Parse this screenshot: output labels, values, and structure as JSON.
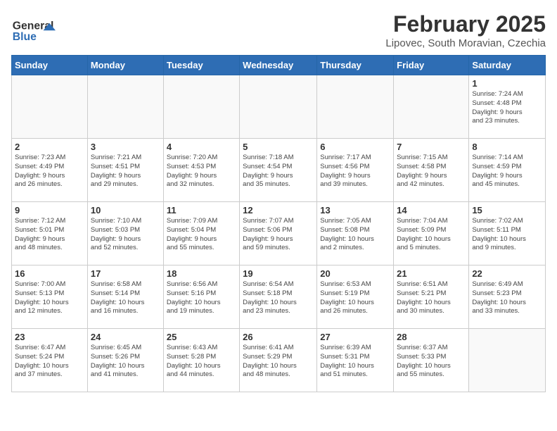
{
  "header": {
    "logo_line1": "General",
    "logo_line2": "Blue",
    "title": "February 2025",
    "subtitle": "Lipovec, South Moravian, Czechia"
  },
  "weekdays": [
    "Sunday",
    "Monday",
    "Tuesday",
    "Wednesday",
    "Thursday",
    "Friday",
    "Saturday"
  ],
  "weeks": [
    [
      {
        "day": "",
        "info": ""
      },
      {
        "day": "",
        "info": ""
      },
      {
        "day": "",
        "info": ""
      },
      {
        "day": "",
        "info": ""
      },
      {
        "day": "",
        "info": ""
      },
      {
        "day": "",
        "info": ""
      },
      {
        "day": "1",
        "info": "Sunrise: 7:24 AM\nSunset: 4:48 PM\nDaylight: 9 hours\nand 23 minutes."
      }
    ],
    [
      {
        "day": "2",
        "info": "Sunrise: 7:23 AM\nSunset: 4:49 PM\nDaylight: 9 hours\nand 26 minutes."
      },
      {
        "day": "3",
        "info": "Sunrise: 7:21 AM\nSunset: 4:51 PM\nDaylight: 9 hours\nand 29 minutes."
      },
      {
        "day": "4",
        "info": "Sunrise: 7:20 AM\nSunset: 4:53 PM\nDaylight: 9 hours\nand 32 minutes."
      },
      {
        "day": "5",
        "info": "Sunrise: 7:18 AM\nSunset: 4:54 PM\nDaylight: 9 hours\nand 35 minutes."
      },
      {
        "day": "6",
        "info": "Sunrise: 7:17 AM\nSunset: 4:56 PM\nDaylight: 9 hours\nand 39 minutes."
      },
      {
        "day": "7",
        "info": "Sunrise: 7:15 AM\nSunset: 4:58 PM\nDaylight: 9 hours\nand 42 minutes."
      },
      {
        "day": "8",
        "info": "Sunrise: 7:14 AM\nSunset: 4:59 PM\nDaylight: 9 hours\nand 45 minutes."
      }
    ],
    [
      {
        "day": "9",
        "info": "Sunrise: 7:12 AM\nSunset: 5:01 PM\nDaylight: 9 hours\nand 48 minutes."
      },
      {
        "day": "10",
        "info": "Sunrise: 7:10 AM\nSunset: 5:03 PM\nDaylight: 9 hours\nand 52 minutes."
      },
      {
        "day": "11",
        "info": "Sunrise: 7:09 AM\nSunset: 5:04 PM\nDaylight: 9 hours\nand 55 minutes."
      },
      {
        "day": "12",
        "info": "Sunrise: 7:07 AM\nSunset: 5:06 PM\nDaylight: 9 hours\nand 59 minutes."
      },
      {
        "day": "13",
        "info": "Sunrise: 7:05 AM\nSunset: 5:08 PM\nDaylight: 10 hours\nand 2 minutes."
      },
      {
        "day": "14",
        "info": "Sunrise: 7:04 AM\nSunset: 5:09 PM\nDaylight: 10 hours\nand 5 minutes."
      },
      {
        "day": "15",
        "info": "Sunrise: 7:02 AM\nSunset: 5:11 PM\nDaylight: 10 hours\nand 9 minutes."
      }
    ],
    [
      {
        "day": "16",
        "info": "Sunrise: 7:00 AM\nSunset: 5:13 PM\nDaylight: 10 hours\nand 12 minutes."
      },
      {
        "day": "17",
        "info": "Sunrise: 6:58 AM\nSunset: 5:14 PM\nDaylight: 10 hours\nand 16 minutes."
      },
      {
        "day": "18",
        "info": "Sunrise: 6:56 AM\nSunset: 5:16 PM\nDaylight: 10 hours\nand 19 minutes."
      },
      {
        "day": "19",
        "info": "Sunrise: 6:54 AM\nSunset: 5:18 PM\nDaylight: 10 hours\nand 23 minutes."
      },
      {
        "day": "20",
        "info": "Sunrise: 6:53 AM\nSunset: 5:19 PM\nDaylight: 10 hours\nand 26 minutes."
      },
      {
        "day": "21",
        "info": "Sunrise: 6:51 AM\nSunset: 5:21 PM\nDaylight: 10 hours\nand 30 minutes."
      },
      {
        "day": "22",
        "info": "Sunrise: 6:49 AM\nSunset: 5:23 PM\nDaylight: 10 hours\nand 33 minutes."
      }
    ],
    [
      {
        "day": "23",
        "info": "Sunrise: 6:47 AM\nSunset: 5:24 PM\nDaylight: 10 hours\nand 37 minutes."
      },
      {
        "day": "24",
        "info": "Sunrise: 6:45 AM\nSunset: 5:26 PM\nDaylight: 10 hours\nand 41 minutes."
      },
      {
        "day": "25",
        "info": "Sunrise: 6:43 AM\nSunset: 5:28 PM\nDaylight: 10 hours\nand 44 minutes."
      },
      {
        "day": "26",
        "info": "Sunrise: 6:41 AM\nSunset: 5:29 PM\nDaylight: 10 hours\nand 48 minutes."
      },
      {
        "day": "27",
        "info": "Sunrise: 6:39 AM\nSunset: 5:31 PM\nDaylight: 10 hours\nand 51 minutes."
      },
      {
        "day": "28",
        "info": "Sunrise: 6:37 AM\nSunset: 5:33 PM\nDaylight: 10 hours\nand 55 minutes."
      },
      {
        "day": "",
        "info": ""
      }
    ]
  ]
}
